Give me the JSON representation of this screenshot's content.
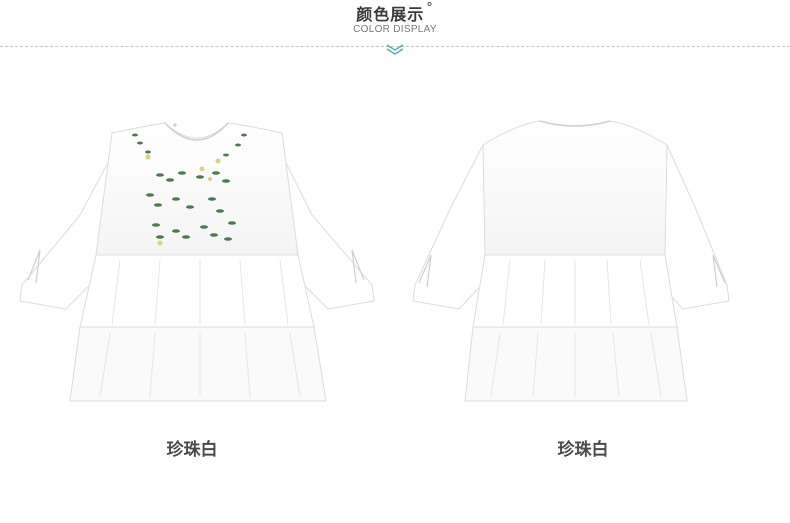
{
  "header": {
    "title": "颜色展示",
    "title_mark": "°",
    "subtitle": "COLOR DISPLAY"
  },
  "products": [
    {
      "color_name": "珍珠白",
      "view": "front",
      "icon": "blouse-front-image"
    },
    {
      "color_name": "珍珠白",
      "view": "back",
      "icon": "blouse-back-image"
    }
  ],
  "colors": {
    "accent": "#4fb1a7",
    "title_text": "#3a3a3a",
    "caption_text": "#4a4a4a",
    "garment": "#ffffff",
    "embroidery_leaf": "#4f7a4f",
    "embroidery_flower": "#d9d37a"
  }
}
